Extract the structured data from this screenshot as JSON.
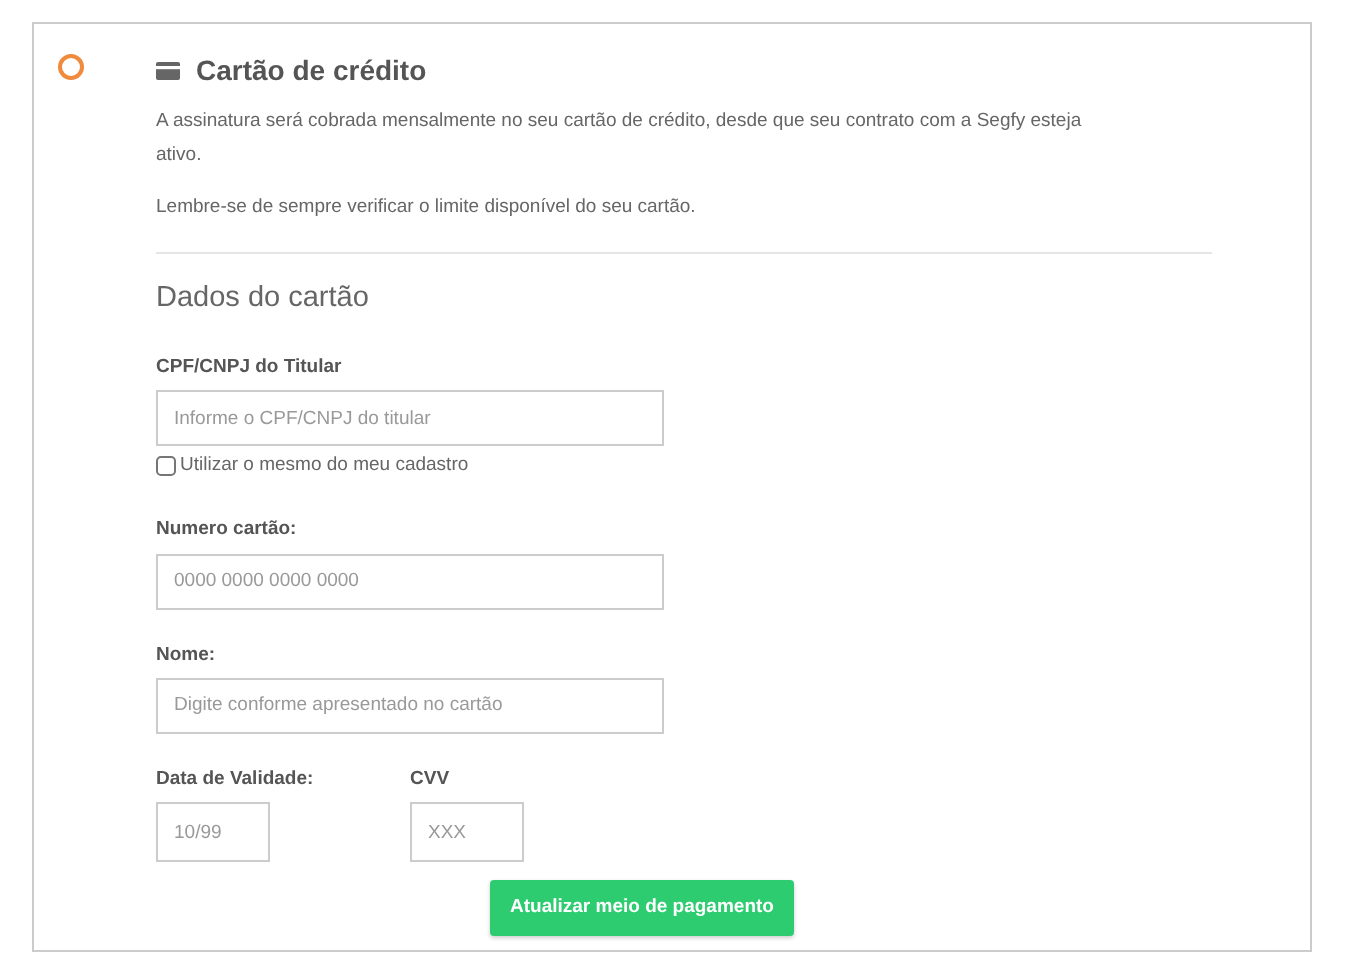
{
  "option": {
    "selected": false,
    "title": "Cartão de crédito"
  },
  "paragraphs": [
    "A assinatura será cobrada mensalmente no seu cartão de crédito, desde que seu contrato com a Segfy esteja ativo.",
    "Lembre-se de sempre verificar o limite disponível do seu cartão."
  ],
  "section_title": "Dados do cartão",
  "holder": {
    "label": "CPF/CNPJ do Titular",
    "placeholder": "Informe o CPF/CNPJ do titular"
  },
  "same_as_profile": {
    "label": "Utilizar o mesmo do meu cadastro",
    "checked": false
  },
  "card_number": {
    "label": "Numero cartão:",
    "placeholder": "0000 0000 0000 0000"
  },
  "name": {
    "label": "Nome:",
    "placeholder": "Digite conforme apresentado no cartão"
  },
  "expiry": {
    "label": "Data de Validade:",
    "placeholder": "10/99"
  },
  "cvv": {
    "label": "CVV",
    "placeholder": "XXX"
  },
  "submit": "Atualizar meio de pagamento"
}
